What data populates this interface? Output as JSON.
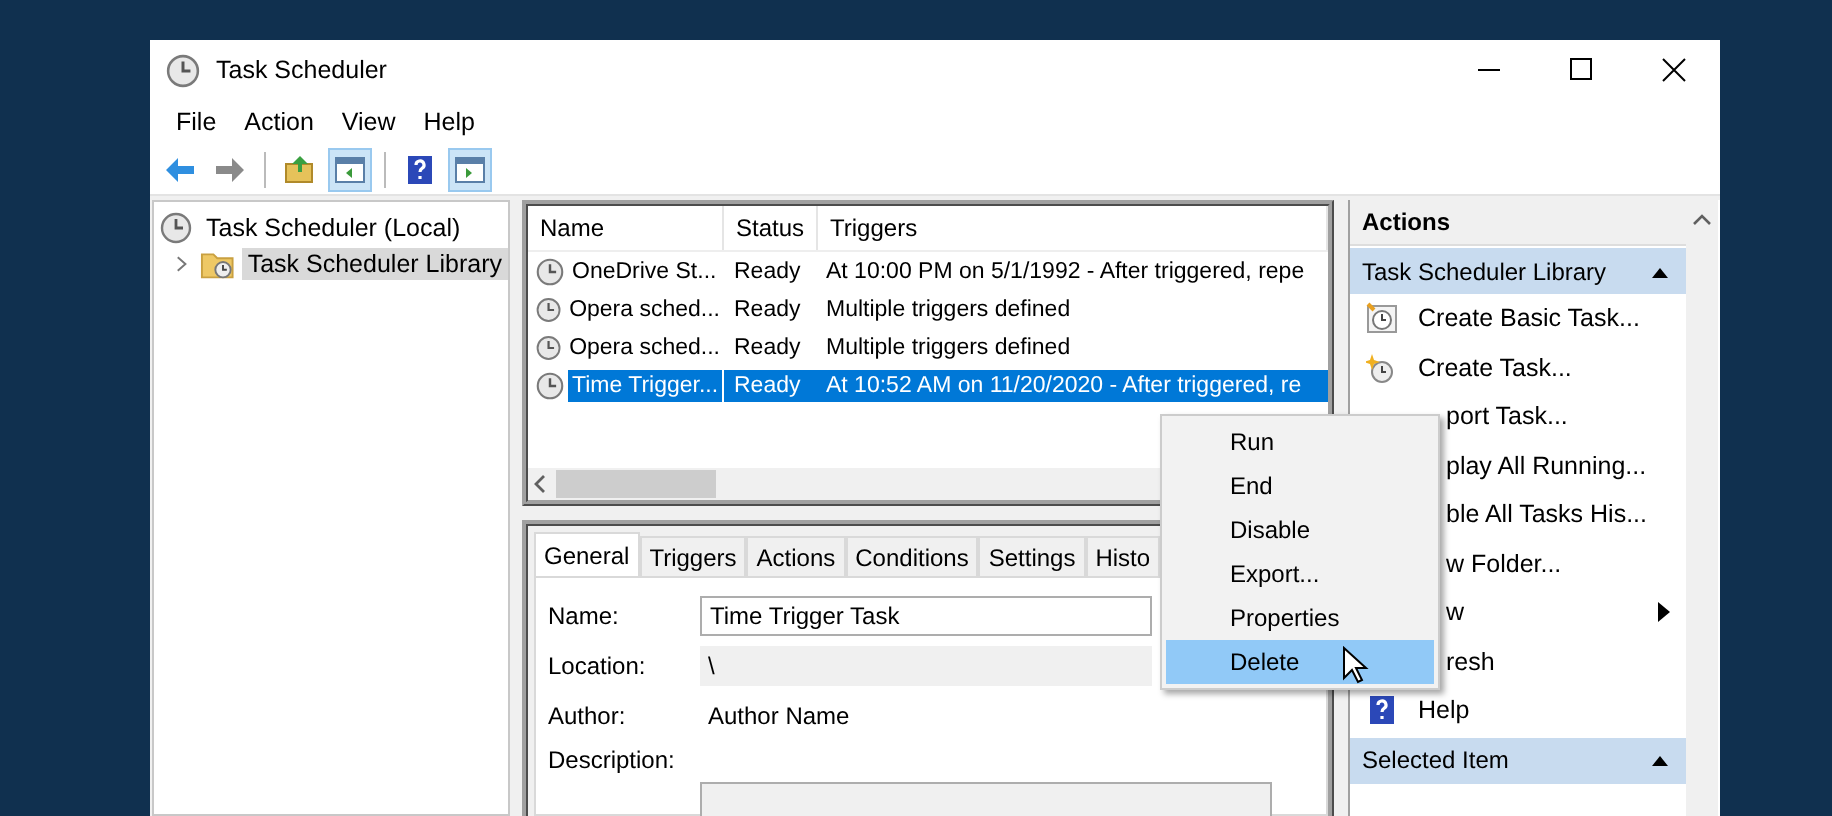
{
  "window": {
    "title": "Task Scheduler"
  },
  "menu_bar": [
    "File",
    "Action",
    "View",
    "Help"
  ],
  "toolbar": [
    {
      "kind": "back",
      "pressed": false
    },
    {
      "kind": "forward",
      "pressed": false
    },
    {
      "kind": "folder-up",
      "pressed": false
    },
    {
      "kind": "tree-pane",
      "pressed": true
    },
    {
      "kind": "help",
      "pressed": false
    },
    {
      "kind": "action-pane",
      "pressed": true
    }
  ],
  "tree": [
    {
      "label": "Task Scheduler (Local)",
      "selected": false,
      "children": [
        {
          "label": "Task Scheduler Library",
          "selected": true,
          "expanded": false
        }
      ]
    }
  ],
  "task_list": {
    "columns": [
      "Name",
      "Status",
      "Triggers"
    ],
    "rows": [
      {
        "name": "OneDrive St...",
        "status": "Ready",
        "triggers": "At 10:00 PM on 5/1/1992 - After triggered, repe",
        "selected": false
      },
      {
        "name": "Opera sched...",
        "status": "Ready",
        "triggers": "Multiple triggers defined",
        "selected": false
      },
      {
        "name": "Opera sched...",
        "status": "Ready",
        "triggers": "Multiple triggers defined",
        "selected": false
      },
      {
        "name": "Time Trigger...",
        "status": "Ready",
        "triggers": "At 10:52 AM on 11/20/2020 - After triggered, re",
        "selected": true
      }
    ]
  },
  "details": {
    "tabs": [
      {
        "label": "General",
        "selected": true
      },
      {
        "label": "Triggers",
        "selected": false
      },
      {
        "label": "Actions",
        "selected": false
      },
      {
        "label": "Conditions",
        "selected": false
      },
      {
        "label": "Settings",
        "selected": false
      },
      {
        "label": "Histo",
        "selected": false
      }
    ],
    "fields": [
      {
        "label": "Name:",
        "kind": "input",
        "value": "Time Trigger Task"
      },
      {
        "label": "Location:",
        "kind": "readonly",
        "value": "\\"
      },
      {
        "label": "Author:",
        "kind": "text",
        "value": "Author Name"
      },
      {
        "label": "Description:",
        "kind": "textarea"
      }
    ]
  },
  "actions": {
    "title": "Actions",
    "sections": [
      {
        "title": "Task Scheduler Library",
        "expanded": true,
        "items": [
          {
            "label": "Create Basic Task...",
            "kind": "basic-task"
          },
          {
            "label": "Create Task...",
            "kind": "task"
          },
          {
            "label": "port Task...",
            "kind": "covered"
          },
          {
            "label": "play All Running...",
            "kind": "covered"
          },
          {
            "label": "ble All Tasks His...",
            "kind": "covered"
          },
          {
            "label": "w Folder...",
            "kind": "covered"
          },
          {
            "label": "w",
            "kind": "covered",
            "submenu": true
          },
          {
            "label": "resh",
            "kind": "covered"
          },
          {
            "label": "Help",
            "kind": "help"
          }
        ]
      },
      {
        "title": "Selected Item",
        "expanded": true
      }
    ]
  },
  "context_menu": [
    {
      "label": "Run",
      "selected": false
    },
    {
      "label": "End",
      "selected": false
    },
    {
      "label": "Disable",
      "selected": false
    },
    {
      "label": "Export...",
      "selected": false
    },
    {
      "label": "Properties",
      "selected": false
    },
    {
      "label": "Delete",
      "selected": true
    }
  ]
}
